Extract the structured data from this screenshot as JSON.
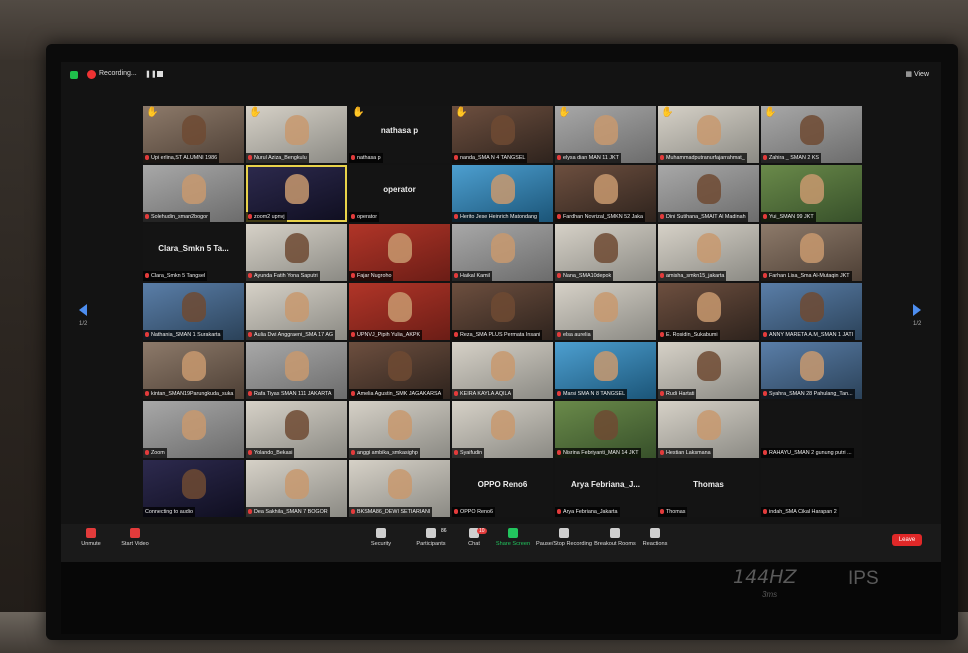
{
  "topbar": {
    "recording_label": "Recording...",
    "view_label": "View"
  },
  "grid": {
    "tiles": [
      {
        "name": "Upi erlina,ST ALUMNI 1986",
        "hand": true,
        "style": "c1"
      },
      {
        "name": "Nurul Aziza_Bengkulu",
        "hand": true,
        "style": "c2"
      },
      {
        "name": "nathasa p",
        "big": "nathasa p",
        "hand": true,
        "style": "blank"
      },
      {
        "name": "nanda_SMA N 4 TANGSEL",
        "hand": true,
        "style": "c3"
      },
      {
        "name": "elysa dian MAN 11 JKT",
        "hand": true,
        "style": "c7"
      },
      {
        "name": "Muhammadputranurfajarrahmat_",
        "hand": true,
        "style": "c2"
      },
      {
        "name": "Zahira _ SMAN 2 KS",
        "hand": true,
        "style": "c7"
      },
      {
        "name": "Solehudin_sman2bogor",
        "style": "c7"
      },
      {
        "name": "zoom2 upnvj",
        "style": "c8",
        "highlight": true
      },
      {
        "name": "operator",
        "big": "operator",
        "style": "blank"
      },
      {
        "name": "Herito Jese Heinrich Matondang",
        "style": "c6"
      },
      {
        "name": "Fardhan Novrizal_SMKN 52 Jaka",
        "style": "c3"
      },
      {
        "name": "Dini Sutihana_SMAIT Al Madinah",
        "style": "c7"
      },
      {
        "name": "Yui_SMAN 99 JKT",
        "style": "c9"
      },
      {
        "name": "Clara_Smkn 5 Tangsel",
        "big": "Clara_Smkn 5 Ta...",
        "style": "blank"
      },
      {
        "name": "Ayunda Fatih Yona Saputri",
        "style": "c2"
      },
      {
        "name": "Fajar Nugroho",
        "style": "c4"
      },
      {
        "name": "Haikal Kamil",
        "style": "c7"
      },
      {
        "name": "Nana_SMA10depok",
        "style": "c2"
      },
      {
        "name": "amisha_smkn15_jakarta",
        "style": "c2"
      },
      {
        "name": "Farhan Lisa_Sma Al-Mutaqin JKT",
        "style": "c1"
      },
      {
        "name": "Nathania_SMAN 1 Surakarta",
        "style": "c5"
      },
      {
        "name": "Aulia Dwi Anggraeni_SMA 17 AG",
        "style": "c2"
      },
      {
        "name": "UPNVJ_Pipih Yulia_AKPK",
        "style": "c4"
      },
      {
        "name": "Reza_SMA PLUS Permata Insani",
        "style": "c3"
      },
      {
        "name": "elsa aurelia",
        "style": "c2"
      },
      {
        "name": "E. Rosidin_Sukabumi",
        "style": "c3"
      },
      {
        "name": "ANNY MARETA A.M_SMAN 1 JATI",
        "style": "c5"
      },
      {
        "name": "kintan_SMAN19Parungkuda_suka",
        "style": "c1"
      },
      {
        "name": "Rafa Tiyas SMAN 111 JAKARTA",
        "style": "c7"
      },
      {
        "name": "Amelia Agustin_SMK JAGAKARSA",
        "style": "c3"
      },
      {
        "name": "KEIRA KAYLA AQILA",
        "style": "c2"
      },
      {
        "name": "Marsi SMA N 8 TANGSEL",
        "style": "c6"
      },
      {
        "name": "Rudi Hartati",
        "style": "c2"
      },
      {
        "name": "Syahra_SMAN 28 Pahulang_Tan...",
        "style": "c5"
      },
      {
        "name": "Zoom",
        "style": "c7"
      },
      {
        "name": "Yolando_Bekasi",
        "style": "c2"
      },
      {
        "name": "anggi ambika_smkasighp",
        "style": "c2"
      },
      {
        "name": "Syaifudin",
        "style": "c2"
      },
      {
        "name": "Nisrina Febriyanti_MAN 14 JKT",
        "style": "c9"
      },
      {
        "name": "Hestian Laksmana",
        "style": "c2"
      },
      {
        "name": "RAHAYU_SMAN 2 gunung putri ...",
        "style": "blank"
      },
      {
        "name": "Connecting to audio",
        "style": "c8",
        "nomic": true
      },
      {
        "name": "Dea Sakhila_SMAN 7 BOGOR",
        "style": "c2"
      },
      {
        "name": "BKSMA86_DEWI SETIARIANI",
        "style": "c2"
      },
      {
        "name": "OPPO Reno6",
        "big": "OPPO Reno6",
        "style": "blank"
      },
      {
        "name": "Arya Febriana_Jakarta",
        "big": "Arya Febriana_J...",
        "style": "blank"
      },
      {
        "name": "Thomas",
        "big": "Thomas",
        "style": "blank"
      },
      {
        "name": "indah_SMA Cikal Harapan 2",
        "style": "blank"
      }
    ]
  },
  "pager": {
    "left_label": "1/2",
    "right_label": "1/2"
  },
  "toolbar": {
    "unmute": "Unmute",
    "start_video": "Start Video",
    "security": "Security",
    "participants": "Participants",
    "participants_count": "86",
    "chat": "Chat",
    "chat_badge": "10",
    "share_screen": "Share Screen",
    "pause_recording": "Pause/Stop Recording",
    "breakout_rooms": "Breakout Rooms",
    "reactions": "Reactions",
    "leave": "Leave"
  },
  "monitor": {
    "brand_hz": "144HZ",
    "brand_ms": "3ms",
    "brand_ips": "IPS"
  },
  "colors": {
    "accent_green": "#22c55e",
    "leave_red": "#e02828",
    "mic_red": "#e23b3b",
    "highlight_yellow": "#e8d24a"
  }
}
